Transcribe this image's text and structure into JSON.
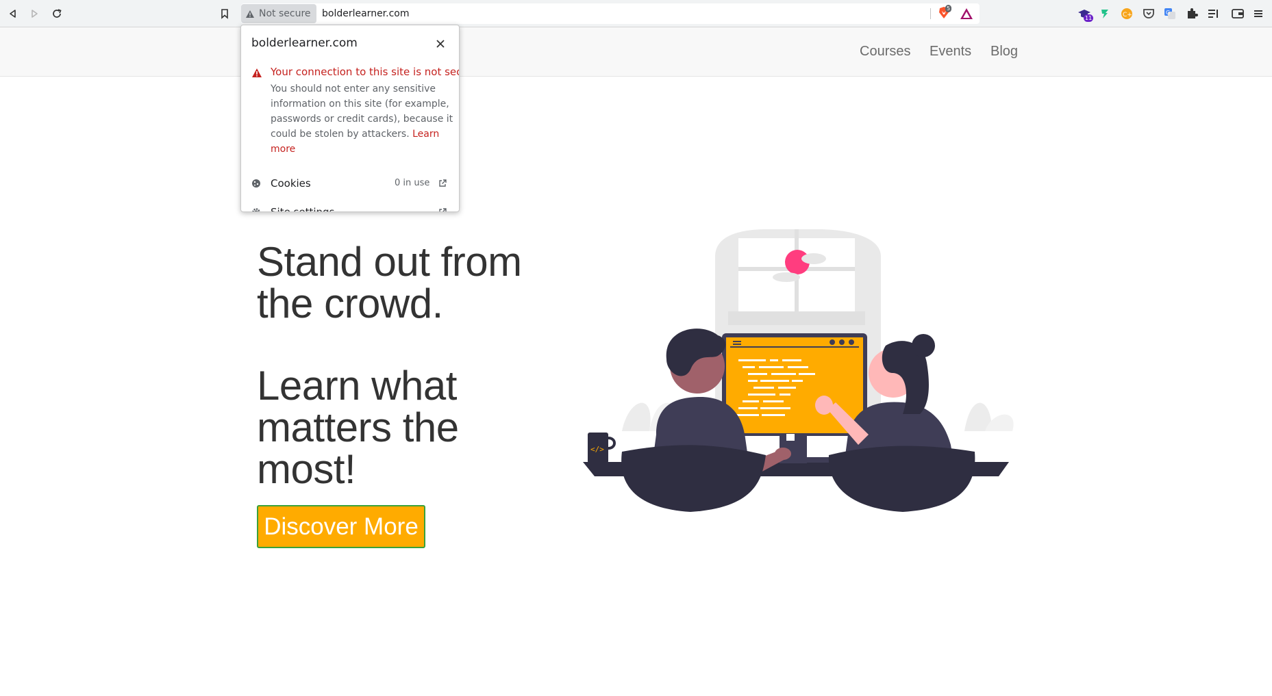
{
  "browser": {
    "security_label": "Not secure",
    "url": "bolderlearner.com",
    "brave_badge": "5",
    "ext_badge": "11"
  },
  "site": {
    "nav": [
      "Courses",
      "Events",
      "Blog"
    ],
    "hero": {
      "line1": "Stand out from",
      "line2": "the crowd.",
      "line3": "Learn what",
      "line4": "matters the",
      "line5": "most!"
    },
    "cta_label": "Discover More"
  },
  "popup": {
    "title": "bolderlearner.com",
    "warning_title": "Your connection to this site is not secure",
    "warning_body": "You should not enter any sensitive information on this site (for example, passwords or credit cards), because it could be stolen by attackers.",
    "learn_more": "Learn more",
    "rows": [
      {
        "label": "Cookies",
        "value": "0 in use"
      },
      {
        "label": "Site settings",
        "value": ""
      }
    ]
  },
  "colors": {
    "accent": "#ffab00",
    "warning": "#c5221f",
    "illustration_dark": "#2f2e41",
    "illustration_pink": "#ff3d7f"
  }
}
